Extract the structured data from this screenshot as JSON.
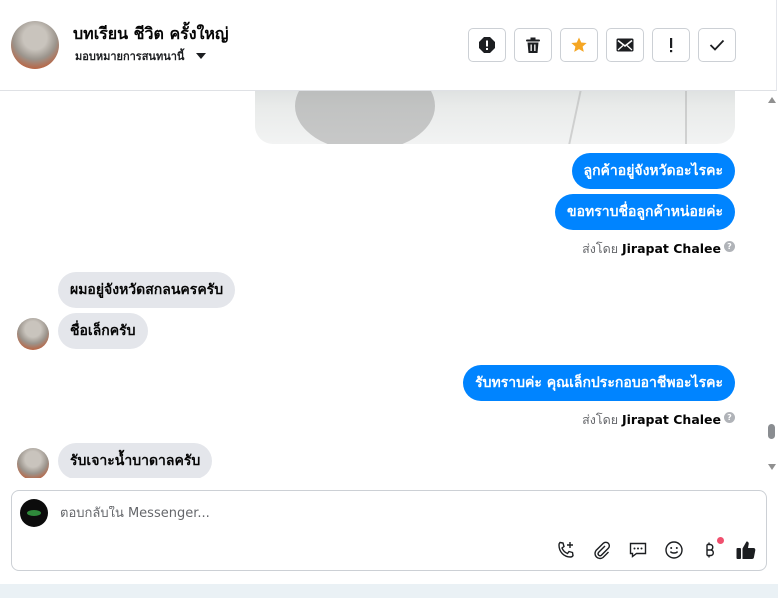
{
  "header": {
    "contact_name": "บทเรียน ชีวิต ครั้งใหญ่",
    "assign_label": "มอบหมายการสนทนานี้",
    "actions": [
      {
        "name": "spam-alert-button",
        "icon": "alert-circle-icon"
      },
      {
        "name": "delete-button",
        "icon": "trash-icon"
      },
      {
        "name": "star-button",
        "icon": "star-icon"
      },
      {
        "name": "mark-unread-button",
        "icon": "envelope-icon"
      },
      {
        "name": "follow-up-button",
        "icon": "exclamation-icon"
      },
      {
        "name": "mark-done-button",
        "icon": "check-icon"
      }
    ]
  },
  "messages": {
    "out1": "ลูกค้าอยู่จังหวัดอะไรคะ",
    "out2": "ขอทราบชื่อลูกค้าหน่อยค่ะ",
    "in1": "ผมอยู่จังหวัดสกลนครครับ",
    "in2": "ชื่อเล็กครับ",
    "out3": "รับทราบค่ะ คุณเล็กประกอบอาชีพอะไรคะ",
    "in3": "รับเจาะน้ำบาดาลครับ"
  },
  "sent_by": {
    "prefix": "ส่งโดย",
    "name": "Jirapat Chalee"
  },
  "composer": {
    "placeholder": "ตอบกลับใน Messenger..."
  },
  "colors": {
    "outgoing_bubble": "#0084ff",
    "incoming_bubble": "#e4e6eb",
    "star": "#f5a623",
    "notification_dot": "#f0506e"
  }
}
